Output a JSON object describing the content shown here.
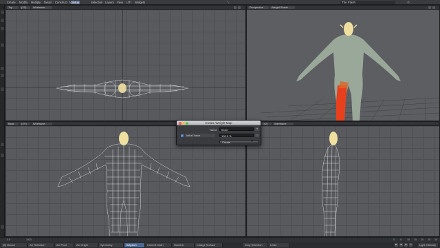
{
  "menubar": {
    "items": [
      "Create",
      "Modify",
      "Multiply",
      "Detail",
      "Construct",
      "Map",
      "Setup",
      "Selection",
      "Layers",
      "View",
      "UTI",
      "Widgets"
    ],
    "active_index": 6,
    "layer_title": "The Flash"
  },
  "viewports": {
    "top": {
      "view": "Top",
      "mode_a": "(XZ)",
      "mode_b": "Wireframe"
    },
    "perspective": {
      "view": "Perspective",
      "mode_b": "Weight Shade"
    },
    "back": {
      "view": "Back",
      "mode_a": "(XY)",
      "mode_b": "Wireframe"
    },
    "right": {
      "view": "Right",
      "mode_a": "(YZ)",
      "mode_b": "Wireframe"
    }
  },
  "dialog": {
    "title": "Create Weight Map",
    "name_label": "Name",
    "name_value": "head",
    "initial_value_label": "Initial Value",
    "initial_value_checked": true,
    "initial_value": "100.0 %",
    "create_label": "Create"
  },
  "status": {
    "ticks": [
      "0",
      "5",
      "10",
      "15",
      "20",
      "25",
      "30",
      "35",
      "40",
      "45",
      "50",
      "55",
      "60"
    ],
    "bottom_buttons": [
      "(B) Mouse",
      "AC Selection",
      "AC Pivot",
      "AC Origin",
      "Symmetry",
      "Hotpatch",
      "Commit Cloth",
      "Numeric",
      "Charge Surface",
      "Drop Selection",
      "Undo"
    ],
    "active_bottom_index": 5,
    "field_left": "0.5",
    "field_frame": "1920",
    "light_label": "Light Intensity"
  },
  "colors": {
    "accent": "#5b6d8a",
    "highlight": "#e8401c",
    "head_skin": "#f0e0a0"
  }
}
